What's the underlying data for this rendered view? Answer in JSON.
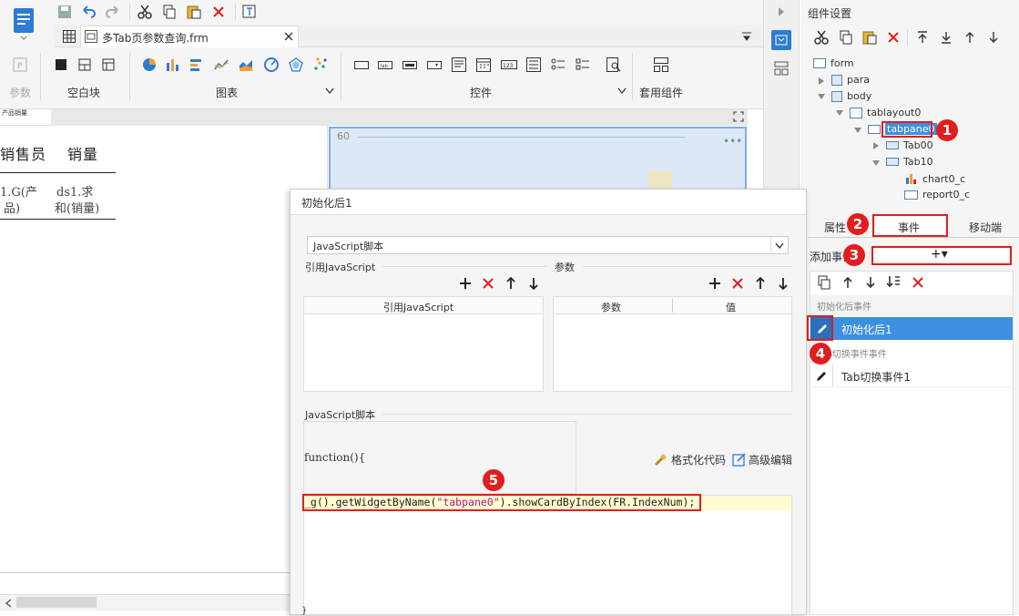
{
  "toolbar": {
    "tab_title": "多Tab页参数查询.frm",
    "group_param": "参数",
    "group_blank": "空白块",
    "group_chart": "图表",
    "group_widget": "控件",
    "group_template": "套用组件"
  },
  "canvas": {
    "header_small": "产品销量",
    "col_salesman": "销售员",
    "col_sales": "销量",
    "cell1_a": "1.G(产",
    "cell1_b": "品)",
    "cell2_a": "ds1.求",
    "cell2_b": "和(销量)",
    "chart_tick": "60"
  },
  "right_panel": {
    "title": "组件设置",
    "tree": {
      "form": "form",
      "para": "para",
      "body": "body",
      "tablayout": "tablayout0",
      "tabpane": "tabpane0",
      "tab00": "Tab00",
      "tab10": "Tab10",
      "chart": "chart0_c",
      "report": "report0_c"
    },
    "tabs": {
      "properties": "属性",
      "events": "事件",
      "mobile": "移动端"
    },
    "add_event_label": "添加事件",
    "add_event_button": "+▾",
    "events": {
      "group1": "初始化后事件",
      "item1": "初始化后1",
      "group2": "Tab切换事件事件",
      "item2": "Tab切换事件1"
    }
  },
  "dialog": {
    "title": "初始化后1",
    "type_select": "JavaScript脚本",
    "ref_js_label": "引用JavaScript",
    "params_label": "参数",
    "ref_js_col": "引用JavaScript",
    "param_col": "参数",
    "value_col": "值",
    "script_label": "JavaScript脚本",
    "function_header": "function(){",
    "format_code": "格式化代码",
    "advanced_edit": "高级编辑",
    "code_line": "_g().getWidgetByName(\"tabpane0\").showCardByIndex(FR.IndexNum);",
    "closing_brace": "}"
  },
  "badges": [
    "1",
    "2",
    "3",
    "4",
    "5"
  ],
  "colors": {
    "accent": "#2b7cd3",
    "highlight_red": "#e11d1d",
    "selection": "#3d8fe0",
    "code_bg": "#fffdd0"
  }
}
